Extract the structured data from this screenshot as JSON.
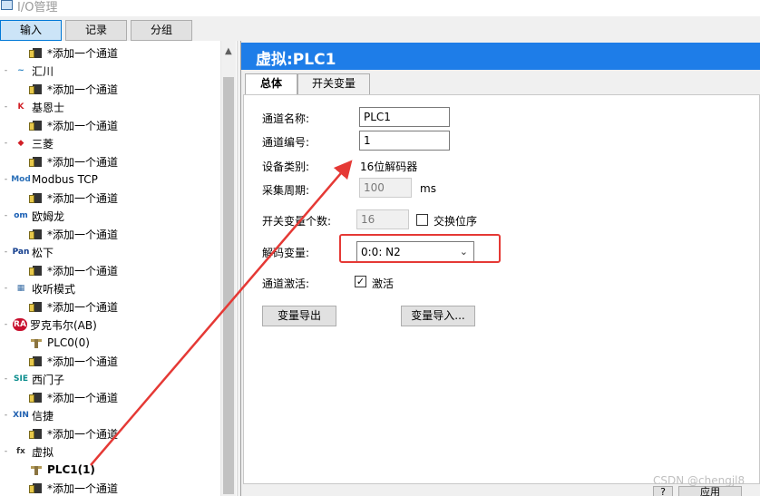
{
  "window": {
    "title": "I/O管理"
  },
  "top_tabs": [
    {
      "label": "输入",
      "active": true
    },
    {
      "label": "记录",
      "active": false
    },
    {
      "label": "分组",
      "active": false
    }
  ],
  "tree": {
    "add_channel_label": "*添加一个通道",
    "items": [
      {
        "type": "add",
        "label": "*添加一个通道"
      },
      {
        "type": "vendor",
        "icon": "huichuan-logo-icon",
        "label": "汇川"
      },
      {
        "type": "add",
        "label": "*添加一个通道"
      },
      {
        "type": "vendor",
        "icon": "keyence-logo-icon",
        "label": "基恩士"
      },
      {
        "type": "add",
        "label": "*添加一个通道"
      },
      {
        "type": "vendor",
        "icon": "mitsubishi-logo-icon",
        "label": "三菱"
      },
      {
        "type": "add",
        "label": "*添加一个通道"
      },
      {
        "type": "vendor",
        "icon": "modbus-logo-icon",
        "label": "Modbus TCP"
      },
      {
        "type": "add",
        "label": "*添加一个通道"
      },
      {
        "type": "vendor",
        "icon": "omron-logo-icon",
        "label": "欧姆龙"
      },
      {
        "type": "add",
        "label": "*添加一个通道"
      },
      {
        "type": "vendor",
        "icon": "panasonic-logo-icon",
        "label": "松下"
      },
      {
        "type": "add",
        "label": "*添加一个通道"
      },
      {
        "type": "vendor",
        "icon": "listen-mode-icon",
        "label": "收听模式"
      },
      {
        "type": "add",
        "label": "*添加一个通道"
      },
      {
        "type": "vendor",
        "icon": "rockwell-logo-icon",
        "label": "罗克韦尔(AB)"
      },
      {
        "type": "plc",
        "label": "PLC0(0)"
      },
      {
        "type": "add",
        "label": "*添加一个通道"
      },
      {
        "type": "vendor",
        "icon": "siemens-logo-icon",
        "label": "西门子"
      },
      {
        "type": "add",
        "label": "*添加一个通道"
      },
      {
        "type": "vendor",
        "icon": "xinje-logo-icon",
        "label": "信捷"
      },
      {
        "type": "add",
        "label": "*添加一个通道"
      },
      {
        "type": "vendor",
        "icon": "virtual-fx-icon",
        "label": "虚拟"
      },
      {
        "type": "plc",
        "label": "PLC1(1)",
        "selected": true
      },
      {
        "type": "add",
        "label": "*添加一个通道"
      }
    ],
    "logo_text": {
      "huichuan": "INOVANCE",
      "keyence": "K",
      "modbus": "Mod bus",
      "omron": "om",
      "panasonic": "Pan",
      "rockwell": "RA",
      "siemens": "SIE",
      "xinje": "XIN",
      "virtual": "fx"
    }
  },
  "detail": {
    "header": "虚拟:PLC1",
    "tabs": [
      {
        "label": "总体",
        "active": true
      },
      {
        "label": "开关变量",
        "active": false
      }
    ],
    "fields": {
      "channel_name_label": "通道名称:",
      "channel_name_value": "PLC1",
      "channel_no_label": "通道编号:",
      "channel_no_value": "1",
      "device_type_label": "设备类别:",
      "device_type_value": "16位解码器",
      "sample_period_label": "采集周期:",
      "sample_period_value": "100",
      "sample_period_unit": "ms",
      "switch_count_label": "开关变量个数:",
      "switch_count_value": "16",
      "swap_order_label": "交换位序",
      "swap_order_checked": false,
      "decode_var_label": "解码变量:",
      "decode_var_value": "0:0: N2",
      "channel_active_label": "通道激活:",
      "activate_label": "激活",
      "activate_checked": true
    },
    "buttons": {
      "export_label": "变量导出",
      "import_label": "变量导入..."
    }
  },
  "footer": {
    "watermark": "CSDN @chengjl8",
    "apply_label": "应用",
    "small_btn_label": "?"
  },
  "colors": {
    "header_blue": "#1e7de8",
    "highlight_red": "#e53935",
    "active_tab": "#cce4f7"
  }
}
